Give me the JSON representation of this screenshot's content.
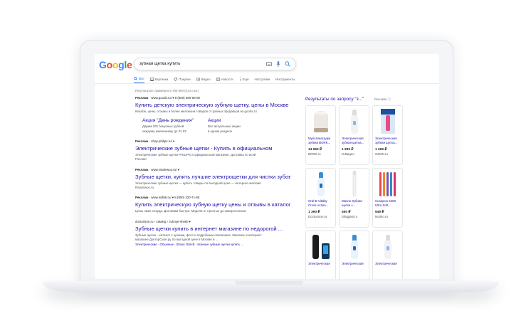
{
  "colors": {
    "link": "#1a0dab",
    "accent": "#1a73e8",
    "text": "#202124",
    "muted": "#70757a"
  },
  "logo": {
    "letters": [
      "G",
      "o",
      "o",
      "g",
      "l",
      "e"
    ],
    "colors": [
      "#4285f4",
      "#ea4335",
      "#fbbc05",
      "#4285f4",
      "#34a853",
      "#ea4335"
    ]
  },
  "search": {
    "value": "зубная щетка купить",
    "icons": [
      "keyboard-icon",
      "mic-icon",
      "search-icon"
    ]
  },
  "tabs": [
    {
      "label": "Все",
      "icon": "search-icon",
      "active": true
    },
    {
      "label": "Картинки",
      "icon": "image-icon"
    },
    {
      "label": "Покупки",
      "icon": "tag-icon"
    },
    {
      "label": "Видео",
      "icon": "video-icon"
    },
    {
      "label": "Новости",
      "icon": "news-icon"
    },
    {
      "label": "Ещё",
      "icon": "more-icon"
    },
    {
      "label": "Настройки"
    },
    {
      "label": "Инструменты"
    }
  ],
  "stats": "Результатов: примерно 5 760 000 (0,54 сек.)",
  "results": [
    {
      "ad_label": "Реклама",
      "url": "www.goods.ru/ ▾   8 (800) 550-80-08",
      "title": "Купить детскую электрическую зубную щетку, цены в Москве",
      "snippet": "Кешбэк, цены, отзывы и более миллиона товаров от разных продавцов на goods.ru",
      "sitelinks": [
        {
          "title": "Акция \"День рождения\"",
          "desc_lines": [
            "Дарим 200 бонусных рублей",
            "каждому имениннику до 31.03"
          ]
        },
        {
          "title": "Акции",
          "desc_lines": [
            "Все актуальные акции",
            "в одном разделе"
          ]
        }
      ]
    },
    {
      "ad_label": "Реклама",
      "url": "shop.philips.ru/ ▾",
      "title": "Электрические зубные щетки - Купить в официальном",
      "snippet_lines": [
        "Электрические зубные щетки PHILIPS в официальном магазине. Доставка по всей",
        "России!"
      ]
    },
    {
      "ad_label": "Реклама",
      "url": "www.randewoo.ru/ ▾",
      "title": "Зубные щетки, купить лучшие электрощетки для чистки зубов",
      "snippet_lines": [
        "Электрические зубные щетки — купить товары по выгодной цене — интернет-магазин",
        "Randewoo.ru"
      ]
    },
    {
      "ad_label": "Реклама",
      "url": "www.irdlink.ru/ ▾   8 (800) 220-71-65",
      "title": "Купить электрическую зубную щетку цены и отзывы в каталоге",
      "snippet_lines": [
        "Цены ниже некуда. Доставим быстро. Модели от простых до навороченных!"
      ]
    },
    {
      "url": "doctorsion.ru › catalog › zubnye-shetki ▾",
      "title": "Зубные щетки купить в интернет магазине по недорогой ...",
      "snippet_lines": [
        "Зубные щетки – каталог с ценами, фото и подробным описанием. Заказать в интернет-",
        "магазине Доктор​Сион.ру по выгодной цене в Москве и ..."
      ],
      "links": "Электрические · Обычные · Braun Oral-B · Ионные зубные щетки купить ..."
    }
  ],
  "shopping": {
    "title": "Результаты по запросу \"з...\"",
    "ad_label": "Реклама ⓘ",
    "items": [
      {
        "name": "Мультинасадка зубная BORK...",
        "price": "14 960 ₽",
        "shop": "BORK.ru",
        "img": "bork"
      },
      {
        "name": "Электрическая зубная щетка...",
        "price": "1 990 ₽",
        "shop": "М.Видео",
        "img": "brush-white"
      },
      {
        "name": "Электрическая зубная щетка...",
        "price": "1 299 ₽",
        "shop": "OZON.ru",
        "img": "oralb-box"
      },
      {
        "name": "Oral-B Vitality Cross Action...",
        "price": "1 390 ₽",
        "shop": "Doctorsion.ru",
        "img": "brush-blue"
      },
      {
        "name": "Marvis Зубная щетка с...",
        "price": "550 ₽",
        "shop": "Shiggani.ru",
        "img": "brush-plain"
      },
      {
        "name": "Curaprox 5460 Ultra Soft...",
        "price": "949 ₽",
        "shop": "Notino.ru",
        "img": "brush-multi"
      },
      {
        "name": "Электрическая",
        "price": "",
        "shop": "",
        "img": "brush-black"
      },
      {
        "name": "Электрическая",
        "price": "",
        "shop": "",
        "img": "brush-blue"
      },
      {
        "name": "Электрическая",
        "price": "",
        "shop": "",
        "img": "brush-white"
      }
    ]
  }
}
